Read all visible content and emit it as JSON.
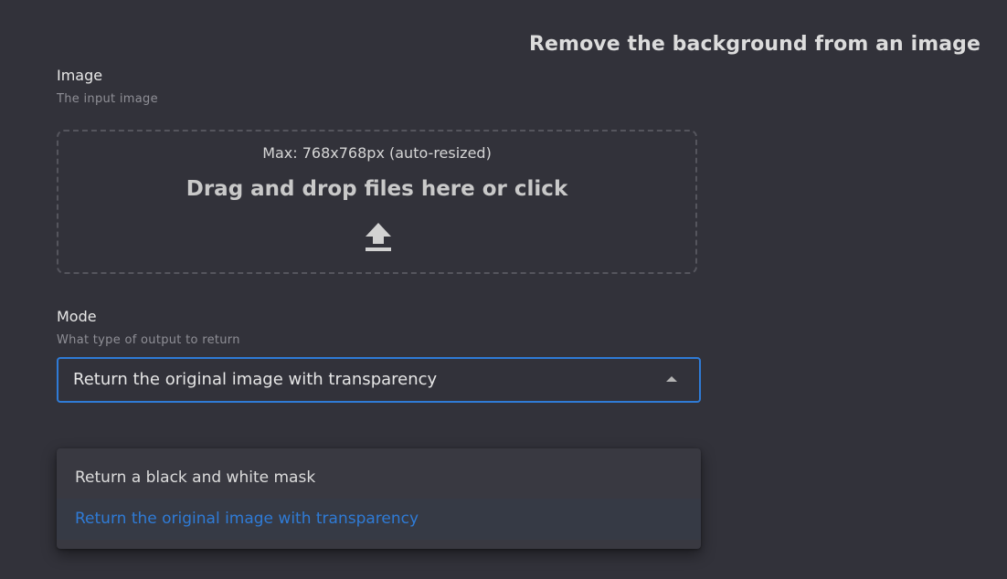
{
  "header": {
    "title": "Remove the background from an image"
  },
  "image_field": {
    "label": "Image",
    "description": "The input image",
    "dropzone": {
      "max_text": "Max: 768x768px (auto-resized)",
      "prompt": "Drag and drop files here or click",
      "icon": "upload-icon"
    }
  },
  "mode_field": {
    "label": "Mode",
    "description": "What type of output to return",
    "selected": "Return the original image with transparency",
    "options": [
      {
        "label": "Return a black and white mask"
      },
      {
        "label": "Return the original image with transparency"
      }
    ]
  },
  "colors": {
    "background": "#32323a",
    "accent": "#2f7bd6",
    "dropdown_bg": "#393941"
  }
}
